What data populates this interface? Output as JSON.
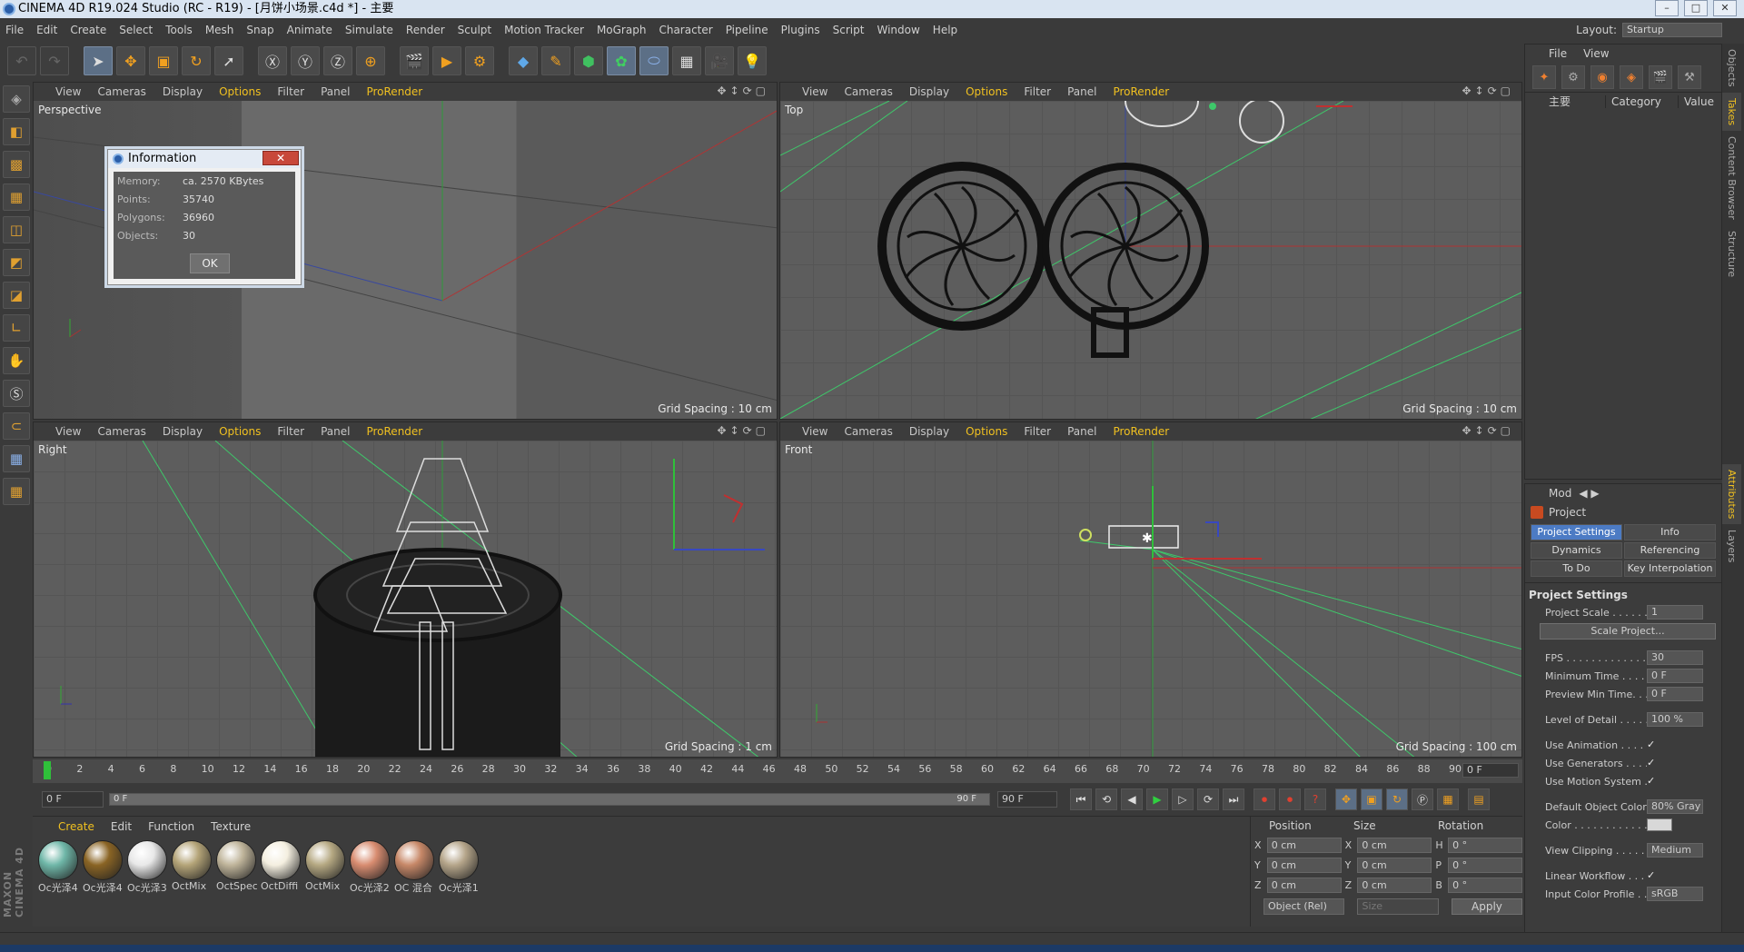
{
  "window": {
    "title": "CINEMA 4D R19.024 Studio (RC - R19) - [月饼小场景.c4d *] - 主要"
  },
  "menu": [
    "File",
    "Edit",
    "Create",
    "Select",
    "Tools",
    "Mesh",
    "Snap",
    "Animate",
    "Simulate",
    "Render",
    "Sculpt",
    "Motion Tracker",
    "MoGraph",
    "Character",
    "Pipeline",
    "Plugins",
    "Script",
    "Window",
    "Help"
  ],
  "layout": {
    "label": "Layout:",
    "value": "Startup"
  },
  "toolbar_icons": [
    "undo-icon",
    "redo-icon",
    "select-arrow-icon",
    "move-icon",
    "scale-icon",
    "rotate-icon",
    "live-select-icon",
    "x-axis-icon",
    "y-axis-icon",
    "z-axis-icon",
    "world-coord-icon",
    "render-view-icon",
    "render-picture-viewer-icon",
    "render-settings-icon",
    "cube-icon",
    "pen-icon",
    "subdivision-icon",
    "cloner-icon",
    "deformer-icon",
    "floor-icon",
    "camera-icon",
    "light-icon"
  ],
  "viewport_menu": {
    "view": "View",
    "cameras": "Cameras",
    "display": "Display",
    "options": "Options",
    "filter": "Filter",
    "panel": "Panel",
    "prorender": "ProRender"
  },
  "viewports": {
    "perspective": {
      "label": "Perspective",
      "grid": "Grid Spacing : 10 cm"
    },
    "top": {
      "label": "Top",
      "grid": "Grid Spacing : 10 cm"
    },
    "right": {
      "label": "Right",
      "grid": "Grid Spacing : 1 cm"
    },
    "front": {
      "label": "Front",
      "grid": "Grid Spacing : 100 cm"
    }
  },
  "info_dialog": {
    "title": "Information",
    "memory_label": "Memory:",
    "memory": "ca. 2570 KBytes",
    "points_label": "Points:",
    "points": "35740",
    "polygons_label": "Polygons:",
    "polygons": "36960",
    "objects_label": "Objects:",
    "objects": "30",
    "ok": "OK"
  },
  "timeline": {
    "ticks": [
      "0",
      "2",
      "4",
      "6",
      "8",
      "10",
      "12",
      "14",
      "16",
      "18",
      "20",
      "22",
      "24",
      "26",
      "28",
      "30",
      "32",
      "34",
      "36",
      "38",
      "40",
      "42",
      "44",
      "46",
      "48",
      "50",
      "52",
      "54",
      "56",
      "58",
      "60",
      "62",
      "64",
      "66",
      "68",
      "70",
      "72",
      "74",
      "76",
      "78",
      "80",
      "82",
      "84",
      "86",
      "88",
      "90"
    ],
    "current": "0 F",
    "start": "0 F",
    "slider_start": "0 F",
    "slider_end": "90 F",
    "end": "90 F"
  },
  "materials": {
    "menu": {
      "create": "Create",
      "edit": "Edit",
      "function": "Function",
      "texture": "Texture"
    },
    "items": [
      {
        "name": "Oc光泽4",
        "color": "#6fb7a8"
      },
      {
        "name": "Oc光泽4",
        "color": "#8a6424"
      },
      {
        "name": "Oc光泽3",
        "color": "#e8e8e8"
      },
      {
        "name": "OctMix",
        "color": "#b4a478"
      },
      {
        "name": "OctSpec",
        "color": "#bfb49a"
      },
      {
        "name": "OctDiffi",
        "color": "#f4efe0"
      },
      {
        "name": "OctMix",
        "color": "#b5a882"
      },
      {
        "name": "Oc光泽2",
        "color": "#d88c70"
      },
      {
        "name": "OC 混合",
        "color": "#c78868"
      },
      {
        "name": "Oc光泽1",
        "color": "#b5a58a"
      }
    ]
  },
  "coordinates": {
    "position_label": "Position",
    "size_label": "Size",
    "rotation_label": "Rotation",
    "rows": [
      {
        "axis": "X",
        "pos": "0 cm",
        "saxis": "X",
        "size": "0 cm",
        "raxis": "H",
        "rot": "0 °"
      },
      {
        "axis": "Y",
        "pos": "0 cm",
        "saxis": "Y",
        "size": "0 cm",
        "raxis": "P",
        "rot": "0 °"
      },
      {
        "axis": "Z",
        "pos": "0 cm",
        "saxis": "Z",
        "size": "0 cm",
        "raxis": "B",
        "rot": "0 °"
      }
    ],
    "mode": "Object (Rel)",
    "size_mode": "Size",
    "apply": "Apply"
  },
  "objects_panel": {
    "menu": {
      "file": "File",
      "view": "View"
    },
    "columns": {
      "name": "主要",
      "category": "Category",
      "value": "Value"
    }
  },
  "side_tabs": [
    "Objects",
    "Takes",
    "Content Browser",
    "Structure",
    "Attributes",
    "Layers"
  ],
  "attributes": {
    "mode": "Mod",
    "header": "Project",
    "tabs": [
      "Project Settings",
      "Info",
      "Dynamics",
      "Referencing",
      "To Do",
      "Key Interpolation"
    ],
    "section": "Project Settings",
    "project_scale_label": "Project Scale . . . . . .",
    "project_scale": "1",
    "scale_project_btn": "Scale Project...",
    "fps_label": "FPS . . . . . . . . . . . . . .",
    "fps": "30",
    "min_time_label": "Minimum Time . . . . . .",
    "min_time": "0 F",
    "preview_min_label": "Preview Min Time. . .",
    "preview_min": "0 F",
    "lod_label": "Level of Detail . . . . .",
    "lod": "100 %",
    "use_anim_label": "Use Animation . . . . .",
    "use_gen_label": "Use Generators . . . .",
    "use_motion_label": "Use Motion System . .",
    "check": "✓",
    "default_color_label": "Default Object Color",
    "default_color": "80% Gray",
    "color_label": "Color . . . . . . . . . . . .",
    "view_clip_label": "View Clipping . . . . . .",
    "view_clip": "Medium",
    "linear_label": "Linear Workflow . . . .",
    "input_profile_label": "Input Color Profile . .",
    "input_profile": "sRGB"
  }
}
